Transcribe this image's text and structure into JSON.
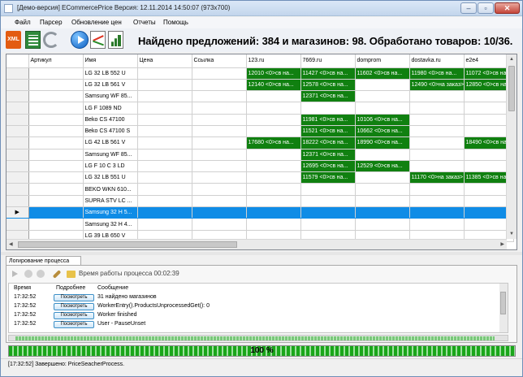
{
  "window": {
    "title": "[Демо-версия] ECommercePrice  Версия: 12.11.2014 14:50:07 (973x700)"
  },
  "menu": [
    "Файл",
    "Парсер",
    "Обновление цен",
    "Отчеты",
    "Помощь"
  ],
  "toolbar": {
    "headline": "Найдено предложений: 384 и магазинов: 98. Обработано товаров: 10/36.",
    "xml_label": "XML"
  },
  "grid": {
    "columns": [
      "",
      "Артикул",
      "Имя",
      "Цена",
      "Ссылка",
      "123.ru",
      "7669.ru",
      "domprom",
      "dostavka.ru",
      "e2e4"
    ],
    "rows": [
      {
        "cells": [
          "",
          "",
          "LG 32 LB 552 U",
          "",
          "",
          "12010 <0>св на...",
          "11427 <0>св на...",
          "11602 <0>св на...",
          "11980 <0>св на...",
          "11072 <0>св на"
        ],
        "green": [
          5,
          6,
          7,
          8,
          9
        ]
      },
      {
        "cells": [
          "",
          "",
          "LG 32 LB 561 V",
          "",
          "",
          "12140 <0>св на...",
          "12578 <0>св на...",
          "",
          "12490 <0>на заказ>",
          "12850 <0>св на"
        ],
        "green": [
          5,
          6,
          8,
          9
        ]
      },
      {
        "cells": [
          "",
          "",
          "Samsung WF 85...",
          "",
          "",
          "",
          "12371 <0>св на...",
          "",
          "",
          ""
        ],
        "green": [
          6
        ]
      },
      {
        "cells": [
          "",
          "",
          "LG F 1089 ND",
          "",
          "",
          "",
          "",
          "",
          "",
          ""
        ],
        "green": []
      },
      {
        "cells": [
          "",
          "",
          "Beko CS 47100",
          "",
          "",
          "",
          "11981 <0>св на...",
          "10106 <0>св на...",
          "",
          ""
        ],
        "green": [
          6,
          7
        ]
      },
      {
        "cells": [
          "",
          "",
          "Beko CS 47100 S",
          "",
          "",
          "",
          "11521 <0>св на...",
          "10662 <0>св на...",
          "",
          ""
        ],
        "green": [
          6,
          7
        ]
      },
      {
        "cells": [
          "",
          "",
          "LG 42 LB 561 V",
          "",
          "",
          "17680 <0>св на...",
          "18222 <0>св на...",
          "18990 <0>св на...",
          "",
          "18490 <0>св на"
        ],
        "green": [
          5,
          6,
          7,
          9
        ]
      },
      {
        "cells": [
          "",
          "",
          "Samsung WF 85...",
          "",
          "",
          "",
          "12371 <0>св на...",
          "",
          "",
          ""
        ],
        "green": [
          6
        ]
      },
      {
        "cells": [
          "",
          "",
          "LG F 10 C 3 LD",
          "",
          "",
          "",
          "12695 <0>св на...",
          "12529 <0>св на...",
          "",
          ""
        ],
        "green": [
          6,
          7
        ]
      },
      {
        "cells": [
          "",
          "",
          "LG 32 LB 551 U",
          "",
          "",
          "",
          "11579 <0>св на...",
          "",
          "11170 <0>на заказ>",
          "11385 <0>св на"
        ],
        "green": [
          6,
          8,
          9
        ]
      },
      {
        "cells": [
          "",
          "",
          "BEKO WKN 610...",
          "",
          "",
          "",
          "",
          "",
          "",
          ""
        ],
        "green": []
      },
      {
        "cells": [
          "",
          "",
          "SUPRA STV LC ...",
          "",
          "",
          "",
          "",
          "",
          "",
          ""
        ],
        "green": []
      },
      {
        "cells": [
          "▶",
          "",
          "Samsung 32 H 5...",
          "",
          "",
          "",
          "",
          "",
          "",
          ""
        ],
        "green": [],
        "selected": true
      },
      {
        "cells": [
          "",
          "",
          "Samsung 32 H 4...",
          "",
          "",
          "",
          "",
          "",
          "",
          ""
        ],
        "green": []
      },
      {
        "cells": [
          "",
          "",
          "LG 39 LB 650 V",
          "",
          "",
          "",
          "",
          "",
          "",
          ""
        ],
        "green": []
      }
    ]
  },
  "log": {
    "tab_label": "Логирование процесса",
    "time_label": "Время работы процесса 00:02:39",
    "headers": [
      "Время",
      "Подробнее",
      "Сообщение"
    ],
    "entries": [
      {
        "time": "17:32:52",
        "button": "Посмотреть",
        "message": "31 найдено магазинов"
      },
      {
        "time": "17:32:52",
        "button": "Посмотреть",
        "message": "WorkerEntry().ProductsUnprocessedGet(): 0"
      },
      {
        "time": "17:32:52",
        "button": "Посмотреть",
        "message": "Worker finished"
      },
      {
        "time": "17:32:52",
        "button": "Посмотреть",
        "message": "User - PauseUnset"
      }
    ]
  },
  "progress": {
    "text": "100 %",
    "value": 100
  },
  "status": {
    "text": "[17:32:52] Завершено: PriceSeacherProcess."
  },
  "colors": {
    "green_cell": "#108010",
    "selected_row": "#0f8ce6",
    "progress": "#1aa61a"
  }
}
